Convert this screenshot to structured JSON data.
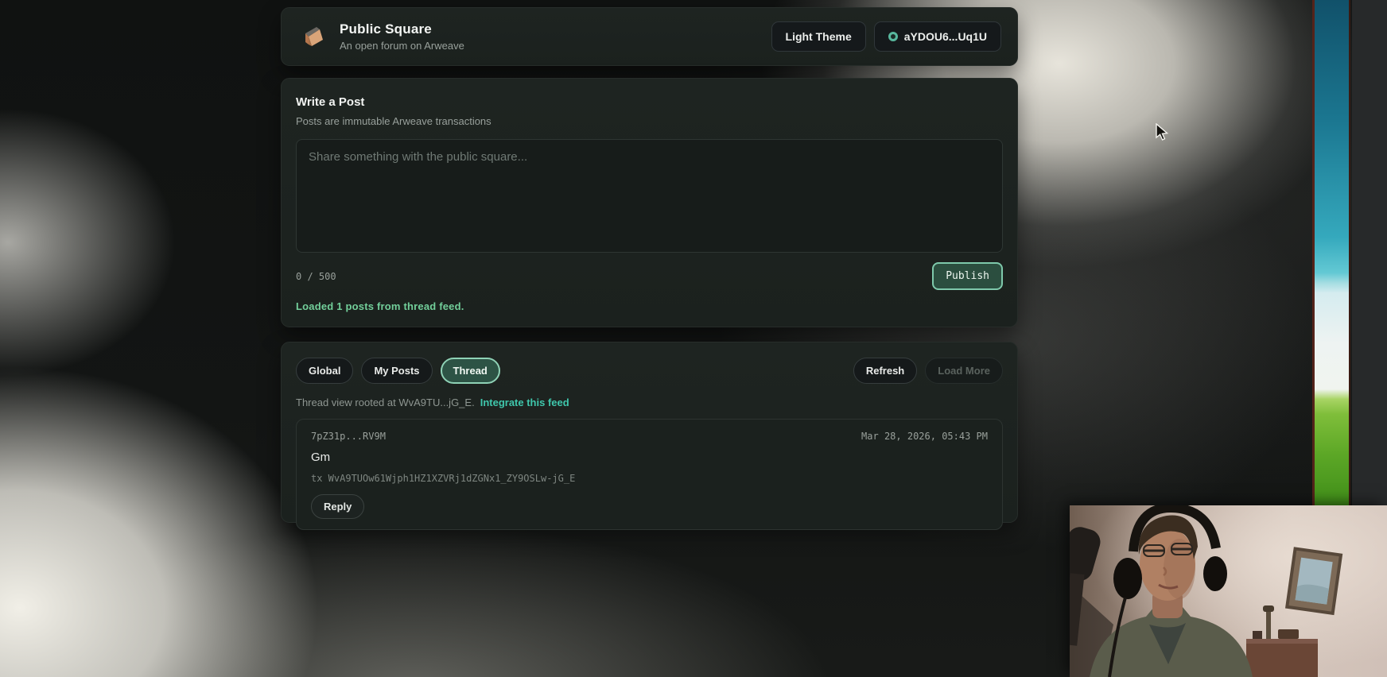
{
  "header": {
    "title": "Public Square",
    "subtitle": "An open forum on Arweave",
    "theme_button": "Light Theme",
    "wallet_button": "aYDOU6...Uq1U"
  },
  "compose": {
    "title": "Write a Post",
    "subtitle": "Posts are immutable Arweave transactions",
    "placeholder": "Share something with the public square...",
    "char_counter": "0 / 500",
    "publish_label": "Publish",
    "status_message": "Loaded 1 posts from thread feed."
  },
  "feed": {
    "tabs": [
      {
        "label": "Global",
        "active": false
      },
      {
        "label": "My Posts",
        "active": false
      },
      {
        "label": "Thread",
        "active": true
      }
    ],
    "refresh_label": "Refresh",
    "load_more_label": "Load More",
    "thread_meta": "Thread view rooted at WvA9TU...jG_E.",
    "integrate_link": "Integrate this feed",
    "posts": [
      {
        "author": "7pZ31p...RV9M",
        "timestamp": "Mar 28, 2026, 05:43 PM",
        "content": "Gm",
        "tx": "tx WvA9TUOw61Wjph1HZ1XZVRj1dZGNx1_ZY9OSLw-jG_E",
        "reply_label": "Reply"
      }
    ]
  },
  "icons": {
    "logo": "parcel-shape",
    "wallet_status": "ring-dot",
    "cursor": "arrow-pointer"
  },
  "colors": {
    "accent_teal": "#3fc7ac",
    "status_green": "#72cf9a",
    "publish_border": "#7ec9ab",
    "logo_tan": "#d9a479",
    "card_bg": "#1c2220",
    "wallet_dot": "#58b79d"
  }
}
